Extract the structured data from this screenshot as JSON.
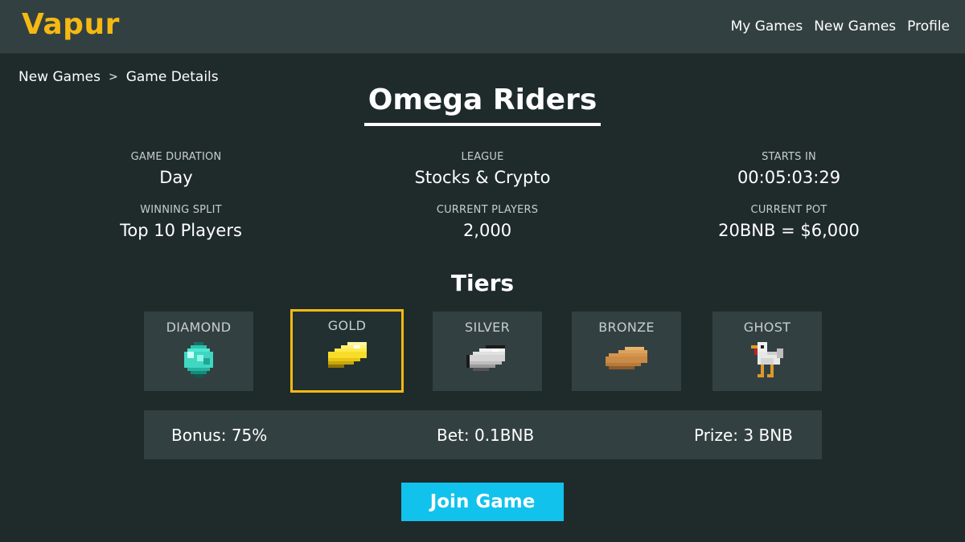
{
  "app": {
    "logo": "Vapur"
  },
  "nav": {
    "items": [
      "My Games",
      "New Games",
      "Profile"
    ]
  },
  "breadcrumb": {
    "items": [
      "New Games",
      "Game Details"
    ],
    "separator": ">"
  },
  "game": {
    "title": "Omega Riders",
    "stats": {
      "duration": {
        "label": "GAME DURATION",
        "value": "Day"
      },
      "league": {
        "label": "LEAGUE",
        "value": "Stocks & Crypto"
      },
      "starts_in": {
        "label": "STARTS IN",
        "value": "00:05:03:29"
      },
      "winning_split": {
        "label": "WINNING SPLIT",
        "value": "Top 10 Players"
      },
      "current_players": {
        "label": "CURRENT PLAYERS",
        "value": "2,000"
      },
      "current_pot": {
        "label": "CURRENT POT",
        "value": "20BNB = $6,000"
      }
    }
  },
  "tiers": {
    "heading": "Tiers",
    "selected": "GOLD",
    "items": [
      {
        "label": "DIAMOND",
        "icon": "diamond-icon"
      },
      {
        "label": "GOLD",
        "icon": "gold-ingot-icon"
      },
      {
        "label": "SILVER",
        "icon": "silver-ingot-icon"
      },
      {
        "label": "BRONZE",
        "icon": "bronze-ingot-icon"
      },
      {
        "label": "GHOST",
        "icon": "chicken-icon"
      }
    ]
  },
  "details": {
    "bonus": "Bonus: 75%",
    "bet": "Bet: 0.1BNB",
    "prize": "Prize: 3 BNB"
  },
  "actions": {
    "join_label": "Join Game"
  },
  "colors": {
    "accent": "#f5b913",
    "button": "#11c2ec",
    "background": "#1f2a2b",
    "panel": "#334042"
  }
}
